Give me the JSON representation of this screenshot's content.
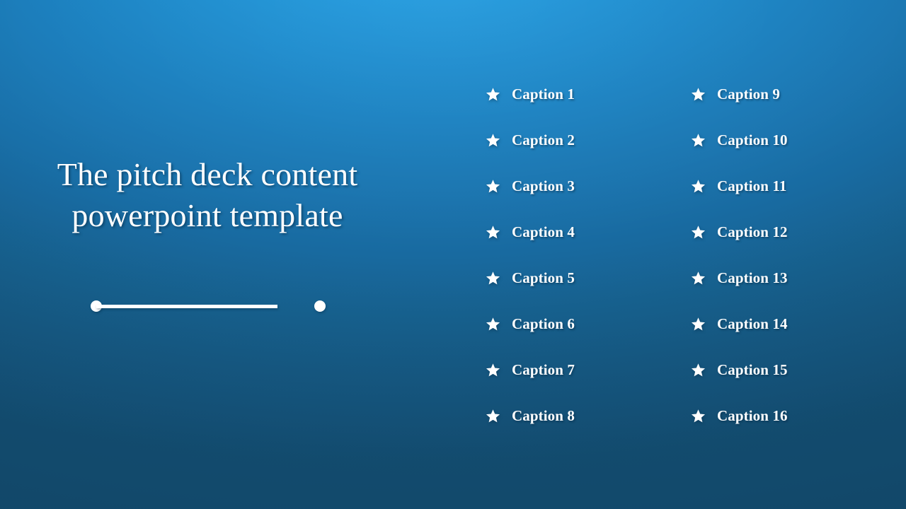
{
  "slide": {
    "title": "The pitch deck content powerpoint template",
    "background": {
      "highlight_color": "#23a3e6",
      "mid_color": "#1a7fbe",
      "shadow_color": "#145074"
    },
    "accent_color": "#ffffff",
    "divider": {
      "name": "title-underline-divider",
      "cap_shape": "circle"
    }
  },
  "captions": {
    "bullet_icon": "star-icon",
    "left_column": [
      {
        "label": "Caption 1"
      },
      {
        "label": "Caption 2"
      },
      {
        "label": "Caption 3"
      },
      {
        "label": "Caption 4"
      },
      {
        "label": "Caption 5"
      },
      {
        "label": "Caption 6"
      },
      {
        "label": "Caption 7"
      },
      {
        "label": "Caption 8"
      }
    ],
    "right_column": [
      {
        "label": "Caption 9"
      },
      {
        "label": "Caption 10"
      },
      {
        "label": "Caption 11"
      },
      {
        "label": "Caption 12"
      },
      {
        "label": "Caption 13"
      },
      {
        "label": "Caption 14"
      },
      {
        "label": "Caption 15"
      },
      {
        "label": "Caption 16"
      }
    ]
  }
}
